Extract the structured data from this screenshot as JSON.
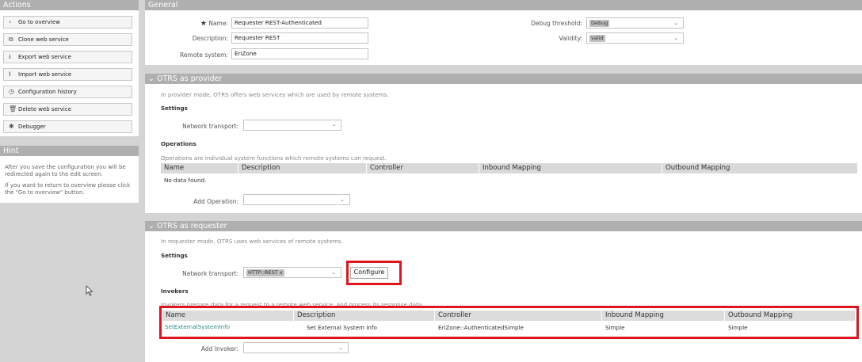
{
  "sidebar": {
    "actions_title": "Actions",
    "actions": [
      {
        "icon": "chevron-left-icon",
        "glyph": "‹",
        "label": "Go to overview"
      },
      {
        "icon": "clone-icon",
        "glyph": "⧉",
        "label": "Clone web service"
      },
      {
        "icon": "export-icon",
        "glyph": "⭳",
        "label": "Export web service"
      },
      {
        "icon": "import-icon",
        "glyph": "⭱",
        "label": "Import web service"
      },
      {
        "icon": "history-icon",
        "glyph": "◷",
        "label": "Configuration history"
      },
      {
        "icon": "trash-icon",
        "glyph": "🗑",
        "label": "Delete web service"
      },
      {
        "icon": "bug-icon",
        "glyph": "✱",
        "label": "Debugger"
      }
    ],
    "hint_title": "Hint",
    "hint_p1": "After you save the configuration you will be redirected again to the edit screen.",
    "hint_p2": "If you want to return to overview please click the \"Go to overview\" button."
  },
  "general": {
    "title": "General",
    "name_label": "Name:",
    "name_value": "Requester REST-Authenticated",
    "description_label": "Description:",
    "description_value": "Requester REST",
    "remote_label": "Remote system:",
    "remote_value": "EriZone",
    "debug_label": "Debug threshold:",
    "debug_value": "Debug",
    "validity_label": "Validity:",
    "validity_value": "valid"
  },
  "provider": {
    "title": "OTRS as provider",
    "intro": "In provider mode, OTRS offers web services which are used by remote systems.",
    "settings": "Settings",
    "transport_label": "Network transport:",
    "transport_value": "",
    "operations_title": "Operations",
    "operations_intro": "Operations are individual system functions which remote systems can request.",
    "columns": [
      "Name",
      "Description",
      "Controller",
      "Inbound Mapping",
      "Outbound Mapping"
    ],
    "empty": "No data found.",
    "add_label": "Add Operation:"
  },
  "requester": {
    "title": "OTRS as requester",
    "intro": "In requester mode, OTRS uses web services of remote systems.",
    "settings": "Settings",
    "transport_label": "Network transport:",
    "transport_value": "HTTP::REST",
    "configure": "Configure",
    "invokers_title": "Invokers",
    "invokers_intro": "Invokers prepare data for a request to a remote web service, and process its response data.",
    "columns": [
      "Name",
      "Description",
      "Controller",
      "Inbound Mapping",
      "Outbound Mapping"
    ],
    "rows": [
      {
        "name": "SetExternalSystemInfo",
        "description": "Set External System Info",
        "controller": "EriZone::AuthenticatedSimple",
        "inbound": "Simple",
        "outbound": "Simple"
      }
    ],
    "add_label": "Add Invoker:"
  },
  "colors": {
    "highlight": "#e0141e",
    "header": "#afafaf",
    "link": "#2a8a8a"
  }
}
